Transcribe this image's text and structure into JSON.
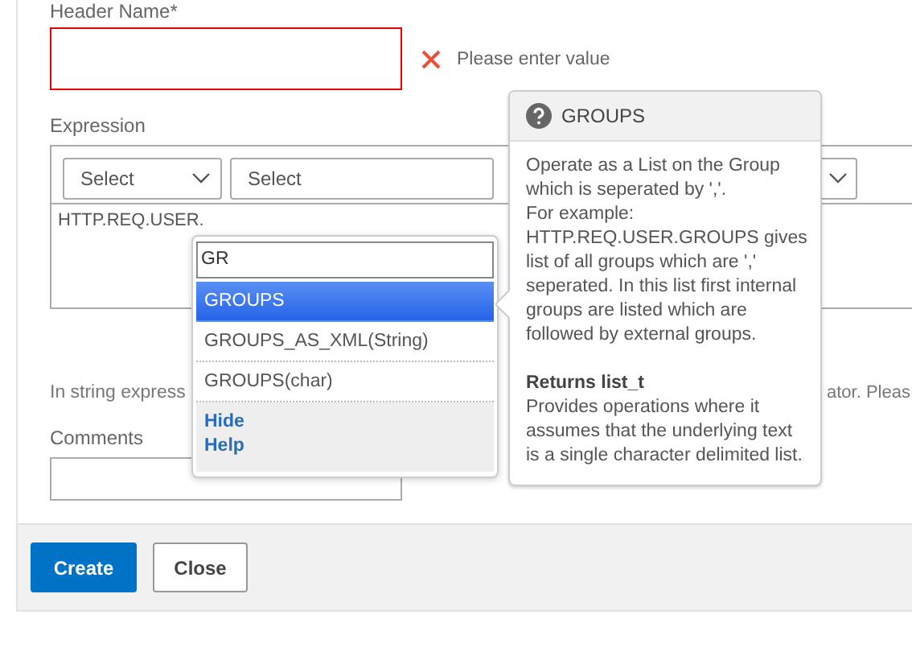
{
  "header_name": {
    "label": "Header Name*",
    "invalid": true,
    "error": "Please enter value"
  },
  "expression": {
    "label": "Expression",
    "selects": [
      {
        "label": "Select",
        "chevron": true
      },
      {
        "label": "Select",
        "chevron": false
      },
      {
        "chevron": true
      }
    ],
    "value": "HTTP.REQ.USER."
  },
  "hint": {
    "before": "In string express",
    "after": "ator. Pleas"
  },
  "comments": {
    "label": "Comments"
  },
  "autocomplete": {
    "query": "GR",
    "items": [
      {
        "label": "GROUPS",
        "selected": true
      },
      {
        "label": "GROUPS_AS_XML(String)",
        "selected": false
      },
      {
        "label": "GROUPS(char)",
        "selected": false
      }
    ],
    "links": [
      "Hide",
      "Help"
    ]
  },
  "tooltip": {
    "title": "GROUPS",
    "description": "Operate as a List on the Group which is seperated by ','.\nFor example: HTTP.REQ.USER.GROUPS gives list of all groups which are ',' seperated. In this list first internal groups are listed which are followed by external groups.",
    "returns_title": "Returns list_t",
    "returns_text": "Provides operations where it assumes that the underlying text is a single character delimited list."
  },
  "buttons": [
    {
      "label": "Create",
      "kind": "primary"
    },
    {
      "label": "Close",
      "kind": "secondary"
    }
  ]
}
